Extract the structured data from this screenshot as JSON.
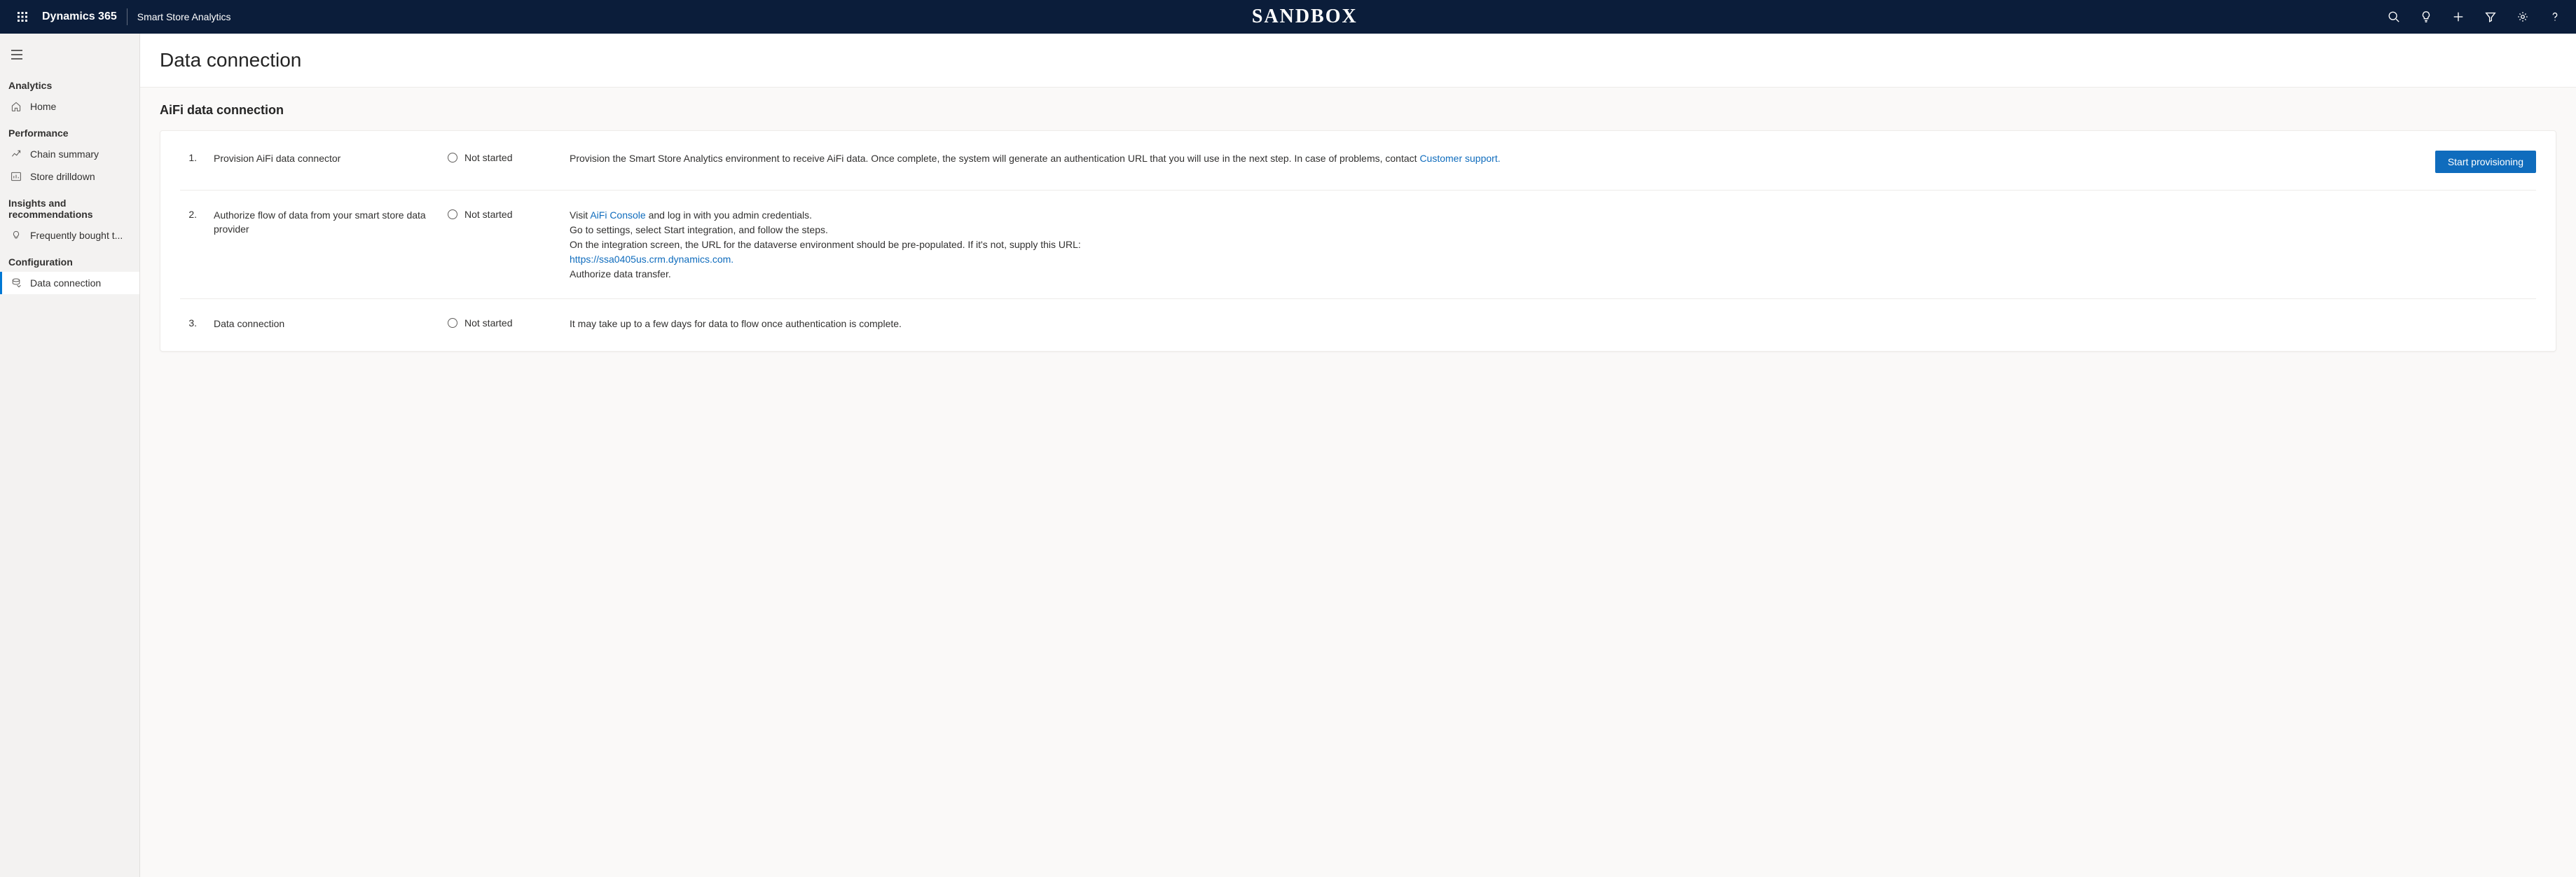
{
  "header": {
    "brand": "Dynamics 365",
    "app_name": "Smart Store Analytics",
    "env_label": "SANDBOX"
  },
  "sidebar": {
    "sections": [
      {
        "label": "Analytics",
        "items": [
          {
            "label": "Home"
          }
        ]
      },
      {
        "label": "Performance",
        "items": [
          {
            "label": "Chain summary"
          },
          {
            "label": "Store drilldown"
          }
        ]
      },
      {
        "label": "Insights and recommendations",
        "items": [
          {
            "label": "Frequently bought t..."
          }
        ]
      },
      {
        "label": "Configuration",
        "items": [
          {
            "label": "Data connection"
          }
        ]
      }
    ]
  },
  "page": {
    "title": "Data connection",
    "section_title": "AiFi data connection",
    "steps": [
      {
        "num": "1.",
        "title": "Provision AiFi data connector",
        "status": "Not started",
        "desc_pre": "Provision the Smart Store Analytics environment to receive AiFi data. Once complete, the system will generate an authentication URL that you will use in the next step. In case of problems, contact ",
        "link1_text": "Customer support.",
        "action_label": "Start provisioning"
      },
      {
        "num": "2.",
        "title": "Authorize flow of data from your smart store data provider",
        "status": "Not started",
        "line1_pre": "Visit ",
        "link1_text": "AiFi Console",
        "line1_post": " and log in with you admin credentials.",
        "line2": "Go to settings, select Start integration, and follow the steps.",
        "line3": "On the integration screen, the URL for the dataverse environment should be pre-populated. If it's not, supply this URL:",
        "link2_text": "https://ssa0405us.crm.dynamics.com.",
        "line5": "Authorize data transfer."
      },
      {
        "num": "3.",
        "title": "Data connection",
        "status": "Not started",
        "desc": "It may take up to a few days for data to flow once authentication is complete."
      }
    ]
  }
}
